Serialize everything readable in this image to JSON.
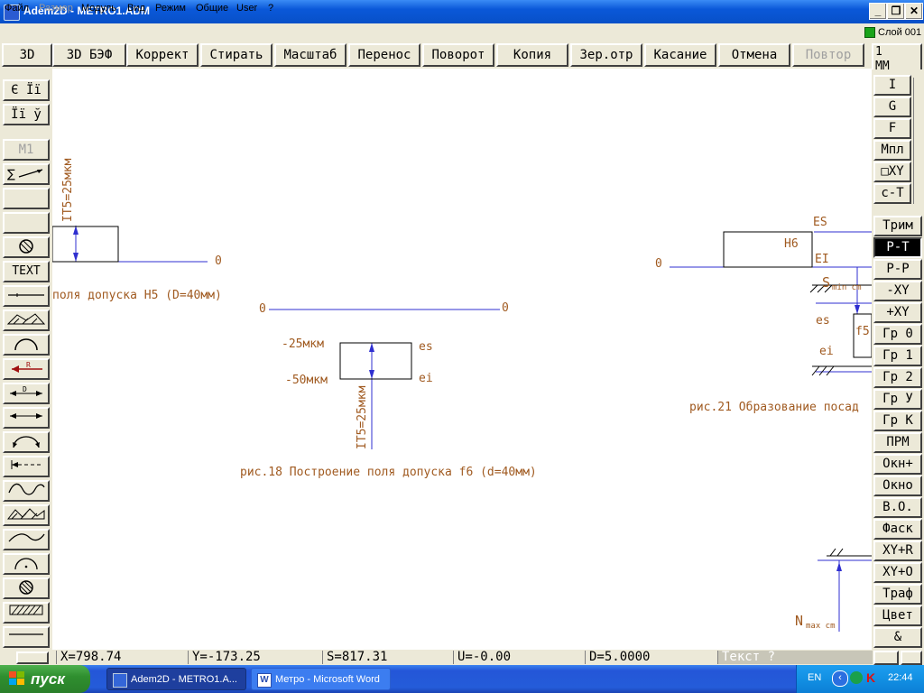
{
  "window": {
    "title": "Adem2D - METRO1.ADM",
    "min_label": "_",
    "restore_label": "❐",
    "close_label": "✕"
  },
  "menu": {
    "items": [
      {
        "label": "Файл",
        "disabled": false
      },
      {
        "label": "Размер",
        "disabled": true
      },
      {
        "label": "Модуль",
        "disabled": false
      },
      {
        "label": "Вид",
        "disabled": false
      },
      {
        "label": "Режим",
        "disabled": false
      },
      {
        "label": "Общие",
        "disabled": false
      },
      {
        "label": "User",
        "disabled": false
      },
      {
        "label": "?",
        "disabled": false
      }
    ],
    "layer": "Слой 001",
    "layer_color": "#19a319"
  },
  "toolbar": {
    "buttons": [
      "3D",
      "3D БЭФ",
      "Коррект",
      "Стирать",
      "Масштаб",
      "Перенос",
      "Поворот",
      "Копия",
      "Зер.отр",
      "Касание",
      "Отмена",
      "Повтор"
    ],
    "disabled": [
      "Повтор"
    ],
    "unit_label": "1\nММ"
  },
  "left_tools": {
    "text_buttons": [
      "Є Її",
      "Її ў",
      "М1",
      "TEXT"
    ]
  },
  "right_panel": {
    "top_buttons": [
      "I",
      "G",
      "F",
      "Мпл",
      "□XY",
      "c-T"
    ],
    "buttons": [
      "Трим",
      "P-T",
      "P-P",
      "-XY",
      "+XY",
      "Гр 0",
      "Гр 1",
      "Гр 2",
      "Гр У",
      "Гр К",
      "ПРМ",
      "Окн+",
      "Окно",
      "В.О.",
      "Фаск",
      "XY+R",
      "XY+O",
      "Траф",
      "Цвет",
      "&"
    ],
    "active": "P-T"
  },
  "drawing": {
    "texts": {
      "it5_left": "IT5=25мкм",
      "zero1": "0",
      "caption_h5": "поля допуска H5 (D=40мм)",
      "zero2": "0",
      "zero3": "0",
      "minus25": "-25мкм",
      "minus50": "-50мкм",
      "es": "es",
      "ei": "ei",
      "it5_mid": "IT5=25мкм",
      "caption_f6": "рис.18 Построение поля допуска f6 (d=40мм)",
      "ES": "ES",
      "EI": "EI",
      "H6": "H6",
      "zero4": "0",
      "smin": "S",
      "smin_sub": "min cm",
      "es2": "es",
      "ei2": "ei",
      "f5": "f5",
      "caption_21": "рис.21 Образование посад",
      "nmax": "N",
      "nmax_sub": "max cm"
    },
    "line_color": "#2f2fd0",
    "text_color": "#a05a20"
  },
  "status": {
    "x": "X=798.74",
    "y": "Y=-173.25",
    "s": "S=817.31",
    "u": "U=-0.00",
    "d": "D=5.0000",
    "text": "Текст ?"
  },
  "taskbar": {
    "start": "пуск",
    "tasks": [
      "Adem2D - METRO1.A...",
      "Метро - Microsoft Word"
    ],
    "lang": "EN",
    "time": "22:44"
  }
}
